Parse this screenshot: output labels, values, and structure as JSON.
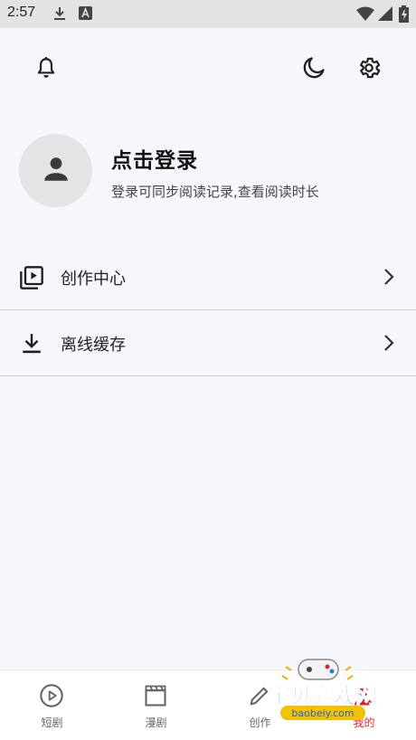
{
  "status_bar": {
    "time": "2:57"
  },
  "header": {
    "bell": "bell-icon",
    "moon": "moon-icon",
    "settings": "gear-icon"
  },
  "profile": {
    "title": "点击登录",
    "subtitle": "登录可同步阅读记录,查看阅读时长"
  },
  "menu": [
    {
      "label": "创作中心",
      "icon": "video-library-icon"
    },
    {
      "label": "离线缓存",
      "icon": "download-icon"
    }
  ],
  "bottom_nav": [
    {
      "label": "短剧",
      "icon": "play-circle-icon"
    },
    {
      "label": "漫剧",
      "icon": "clapperboard-icon"
    },
    {
      "label": "创作",
      "icon": "pencil-icon"
    },
    {
      "label": "我的",
      "icon": "person-icon",
      "active": true
    }
  ],
  "watermark": {
    "title": "宝贝游戏网",
    "url": "baobeiy.com"
  },
  "colors": {
    "background": "#f6f7fd",
    "icon": "#2b2b2b",
    "active": "#e0252a"
  }
}
